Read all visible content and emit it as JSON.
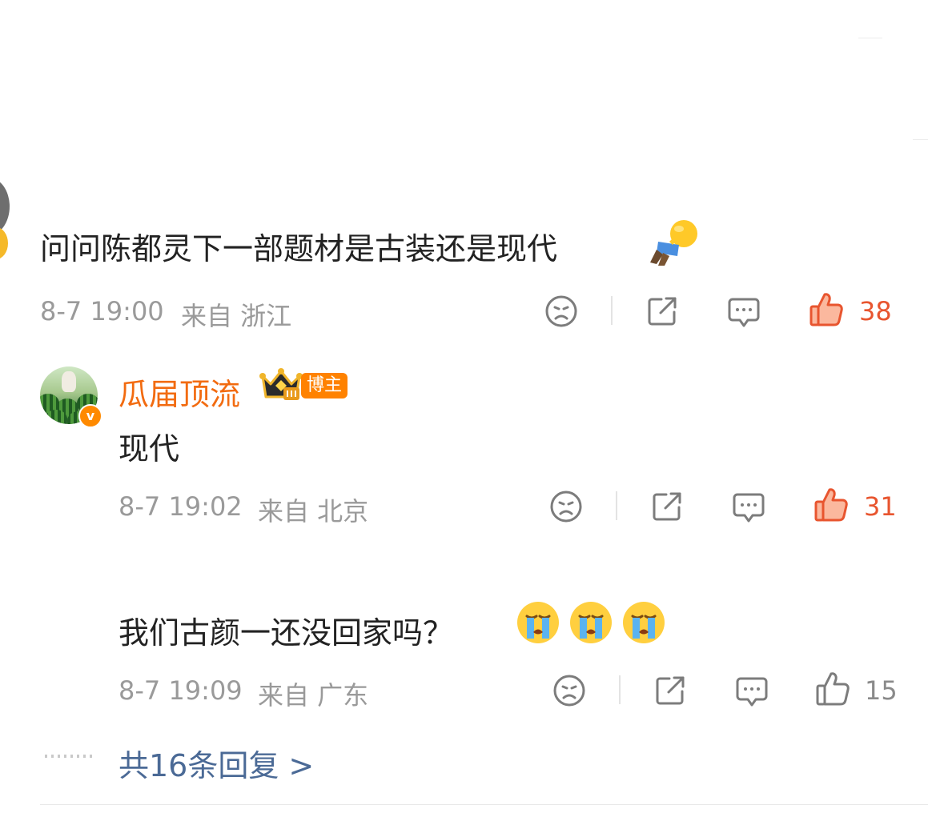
{
  "colors": {
    "like_active": "#e8552f",
    "username": "#f26b10",
    "link": "#4b6a96",
    "meta": "#9a9a9a"
  },
  "comments": [
    {
      "text": "问问陈都灵下一部题材是古装还是现代",
      "emoji": "flying-person-emoji",
      "time": "8-7 19:00",
      "source": "来自 浙江",
      "likes": "38",
      "liked": true
    },
    {
      "username": "瓜届顶流",
      "badge": "博主",
      "text": "现代",
      "time": "8-7 19:02",
      "source": "来自 北京",
      "likes": "31",
      "liked": true
    },
    {
      "text": "我们古颜一还没回家吗？",
      "emoji": [
        "crying-face-emoji",
        "crying-face-emoji",
        "crying-face-emoji"
      ],
      "time": "8-7 19:09",
      "source": "来自 广东",
      "likes": "15",
      "liked": false
    }
  ],
  "more_replies": "共16条回复 >",
  "icons": [
    "dislike-face-icon",
    "share-icon",
    "comment-icon",
    "like-thumb-icon"
  ]
}
